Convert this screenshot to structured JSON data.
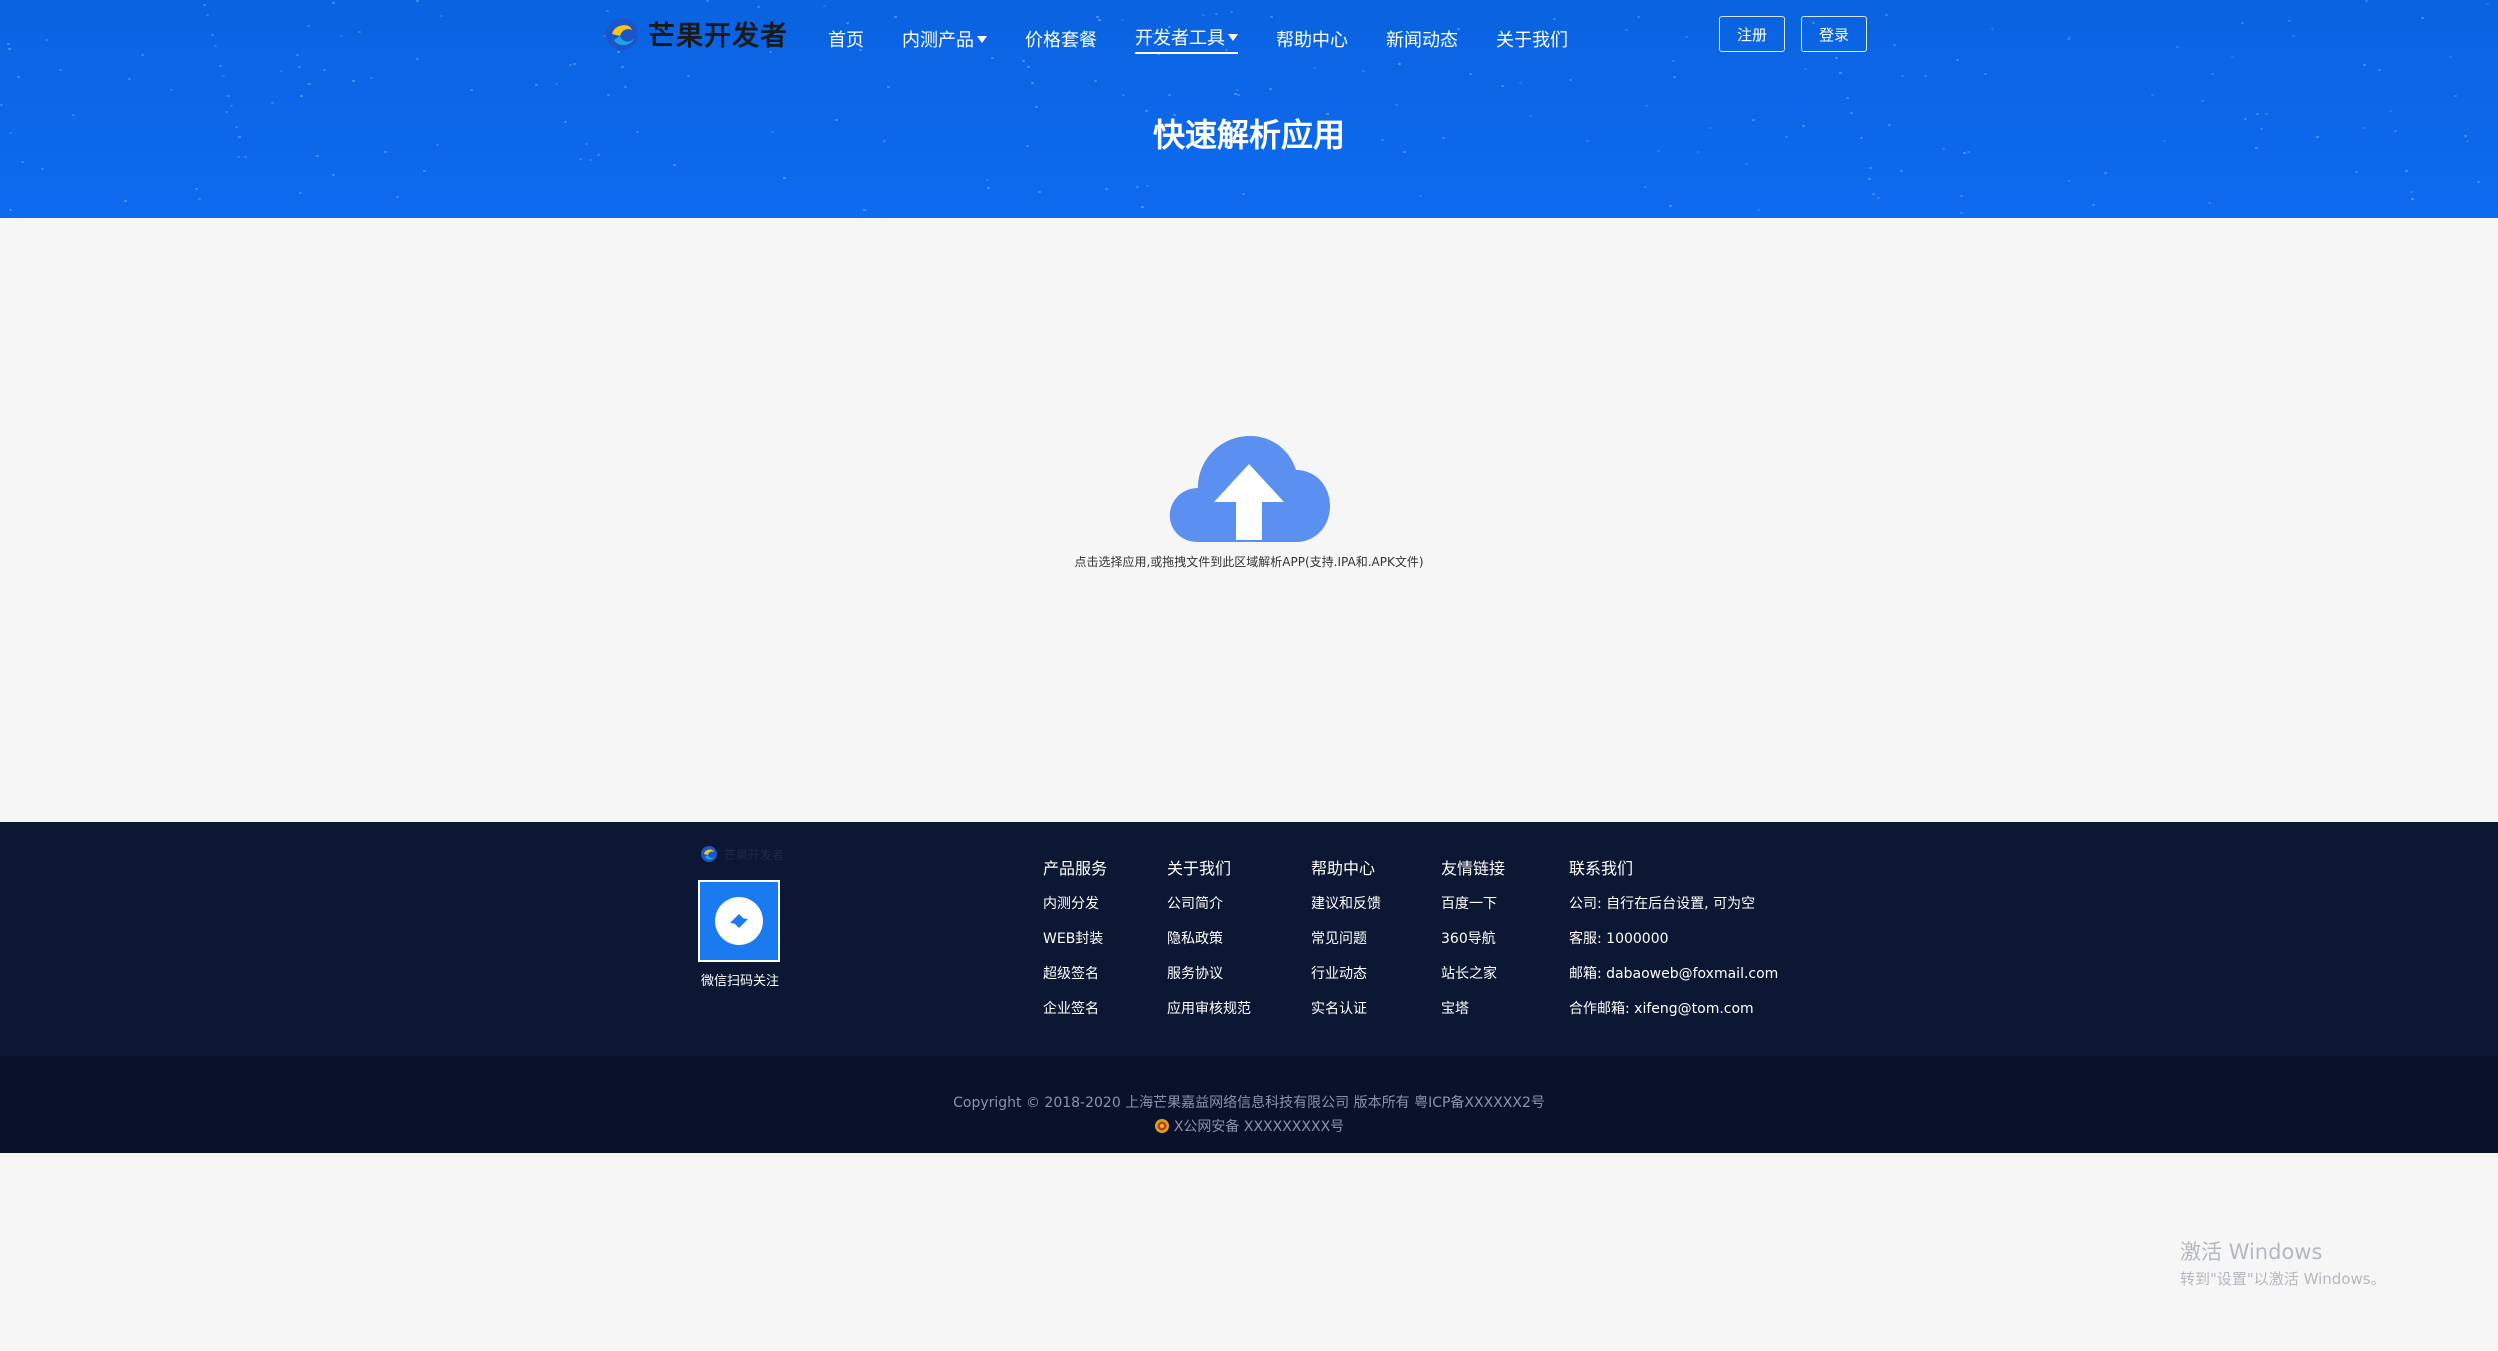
{
  "brand": {
    "name": "芒果开发者"
  },
  "nav": {
    "items": [
      {
        "label": "首页",
        "dropdown": false,
        "active": false
      },
      {
        "label": "内测产品",
        "dropdown": true,
        "active": false
      },
      {
        "label": "价格套餐",
        "dropdown": false,
        "active": false
      },
      {
        "label": "开发者工具",
        "dropdown": true,
        "active": true
      },
      {
        "label": "帮助中心",
        "dropdown": false,
        "active": false
      },
      {
        "label": "新闻动态",
        "dropdown": false,
        "active": false
      },
      {
        "label": "关于我们",
        "dropdown": false,
        "active": false
      }
    ],
    "register_label": "注册",
    "login_label": "登录"
  },
  "hero": {
    "title": "快速解析应用"
  },
  "upload": {
    "icon": "cloud-upload-icon",
    "hint": "点击选择应用,或拖拽文件到此区域解析APP(支持.IPA和.APK文件)"
  },
  "footer": {
    "logo_text": "芒果开发者",
    "qr_label": "微信扫码关注",
    "columns": [
      {
        "title": "产品服务",
        "links": [
          "内测分发",
          "WEB封装",
          "超级签名",
          "企业签名"
        ]
      },
      {
        "title": "关于我们",
        "links": [
          "公司简介",
          "隐私政策",
          "服务协议",
          "应用审核规范"
        ]
      },
      {
        "title": "帮助中心",
        "links": [
          "建议和反馈",
          "常见问题",
          "行业动态",
          "实名认证"
        ]
      },
      {
        "title": "友情链接",
        "links": [
          "百度一下",
          "360导航",
          "站长之家",
          "宝塔"
        ]
      }
    ],
    "contact": {
      "title": "联系我们",
      "rows": [
        "公司:  自行在后台设置, 可为空",
        "客服:  1000000",
        "邮箱:  dabaoweb@foxmail.com",
        "合作邮箱:  xifeng@tom.com"
      ]
    },
    "copyright": "Copyright © 2018-2020 上海芒果嘉益网络信息科技有限公司 版本所有 粤ICP备XXXXXX2号",
    "police": "X公网安备 XXXXXXXXX号"
  },
  "watermark": {
    "line1": "激活 Windows",
    "line2": "转到\"设置\"以激活 Windows。"
  },
  "colors": {
    "header_blue": "#0a63e0",
    "footer_navy": "#0c1733",
    "cloud_blue": "#5b8ff0"
  }
}
